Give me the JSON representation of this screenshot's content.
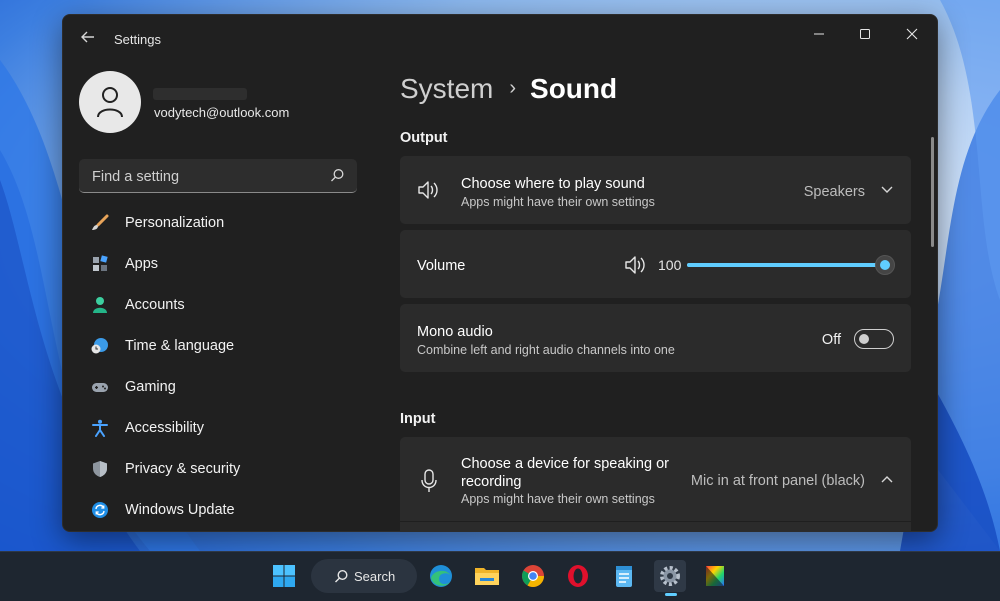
{
  "window": {
    "title": "Settings",
    "minimize_icon": "minimize-icon",
    "maximize_icon": "maximize-icon",
    "close_icon": "close-icon"
  },
  "profile": {
    "email": "vodytech@outlook.com"
  },
  "search": {
    "placeholder": "Find a setting"
  },
  "sidebar": {
    "items": [
      {
        "label": "Personalization",
        "icon": "brush-icon"
      },
      {
        "label": "Apps",
        "icon": "apps-icon"
      },
      {
        "label": "Accounts",
        "icon": "person-icon"
      },
      {
        "label": "Time & language",
        "icon": "globe-clock-icon"
      },
      {
        "label": "Gaming",
        "icon": "gamepad-icon"
      },
      {
        "label": "Accessibility",
        "icon": "accessibility-icon"
      },
      {
        "label": "Privacy & security",
        "icon": "shield-icon"
      },
      {
        "label": "Windows Update",
        "icon": "update-icon"
      }
    ]
  },
  "main": {
    "breadcrumb_parent": "System",
    "breadcrumb_current": "Sound",
    "output_label": "Output",
    "output_device": {
      "title": "Choose where to play sound",
      "subtitle": "Apps might have their own settings",
      "value": "Speakers"
    },
    "volume": {
      "label": "Volume",
      "value": "100",
      "level": 1.0
    },
    "mono_audio": {
      "title": "Mono audio",
      "subtitle": "Combine left and right audio channels into one",
      "state": "Off"
    },
    "input_label": "Input",
    "input_device": {
      "title": "Choose a device for speaking or recording",
      "subtitle": "Apps might have their own settings",
      "value": "Mic in at front panel (black)"
    }
  },
  "taskbar": {
    "search_label": "Search",
    "accent": "#60cdff"
  }
}
